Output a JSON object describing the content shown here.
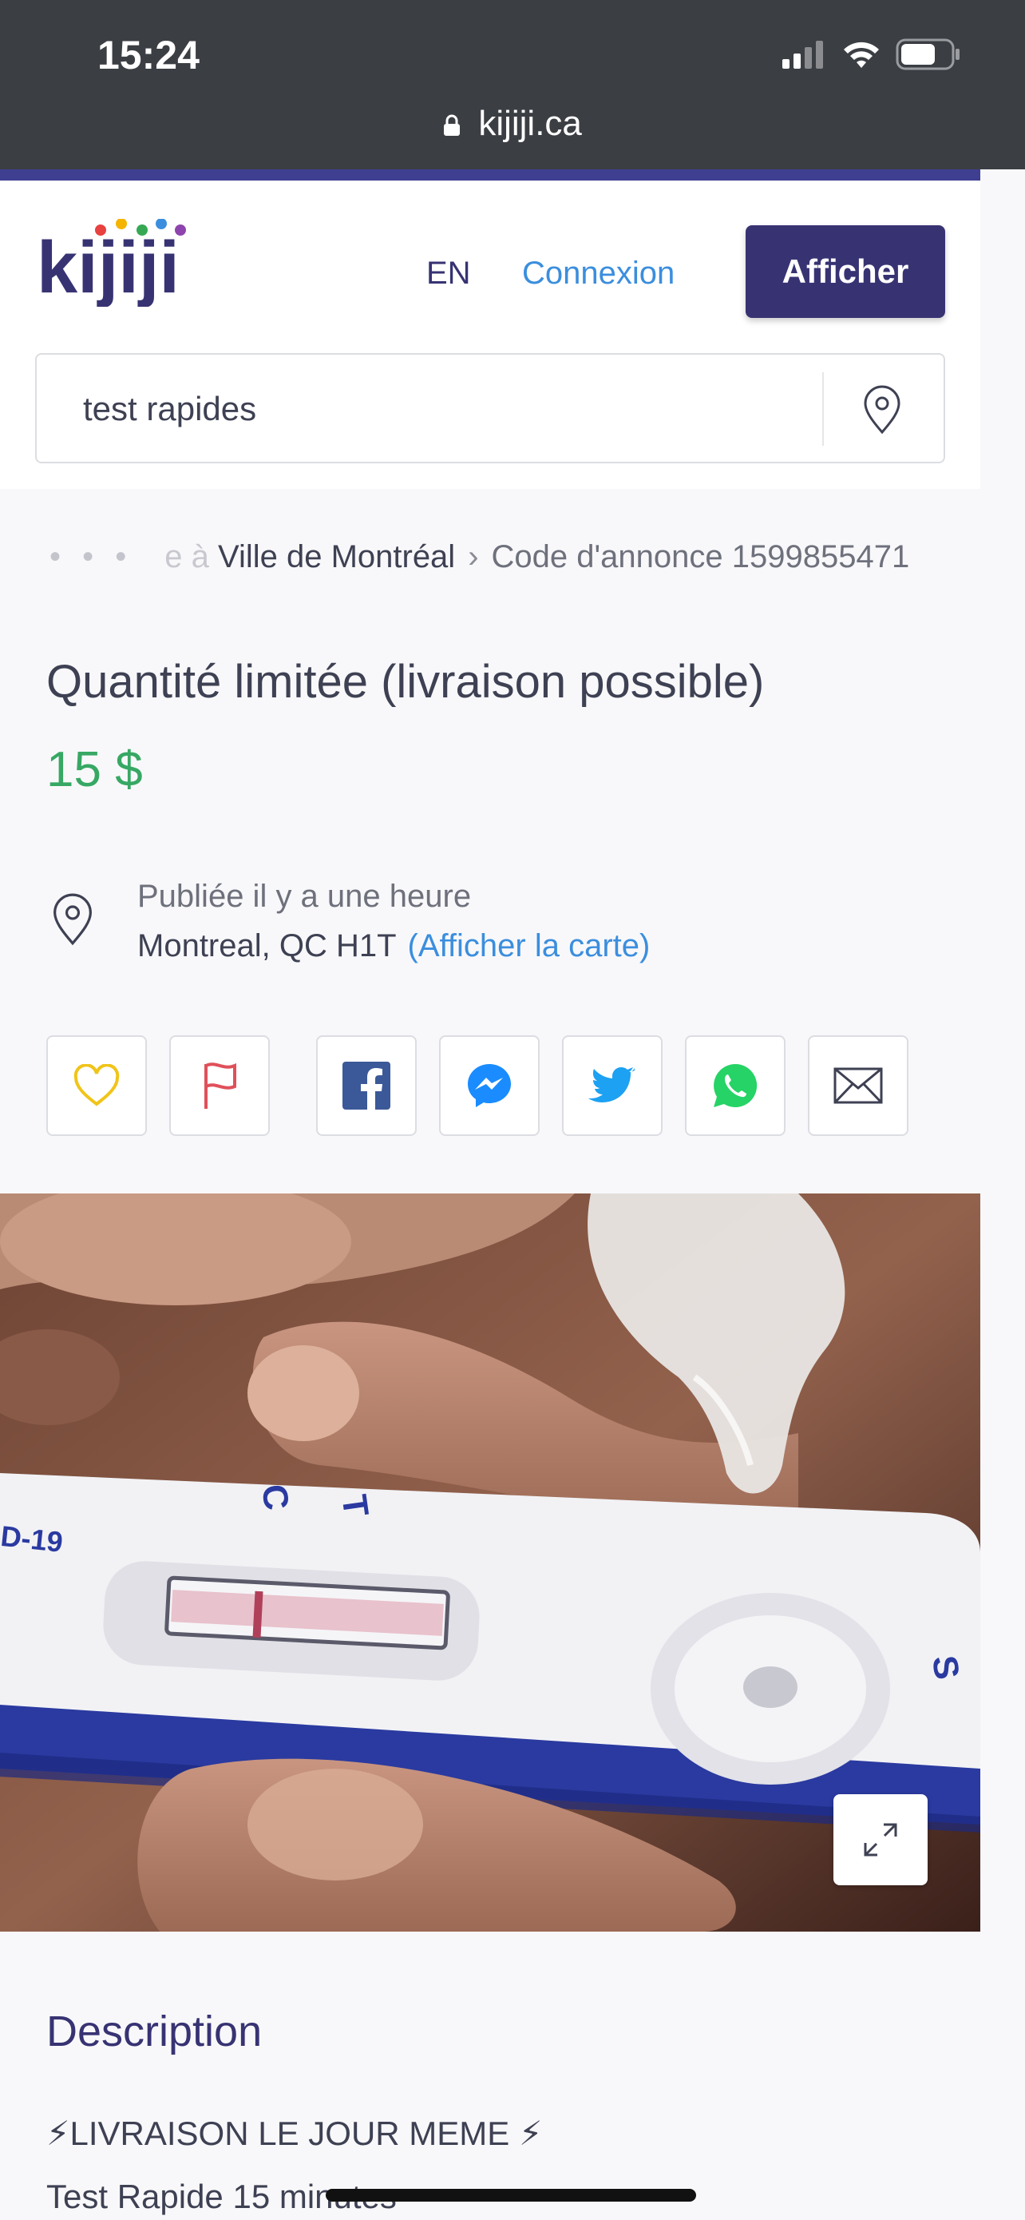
{
  "status_bar": {
    "time": "15:24",
    "url": "kijiji.ca"
  },
  "header": {
    "logo_text": "kijiji",
    "lang": "EN",
    "login": "Connexion",
    "post_button": "Afficher",
    "search_value": "test rapides"
  },
  "breadcrumb": {
    "ellipsis": "• • •",
    "faded": "e à",
    "city": "Ville de Montréal",
    "separator": "›",
    "ad_code": "Code d'annonce 1599855471"
  },
  "listing": {
    "title": "Quantité limitée (livraison possible)",
    "price": "15 $",
    "posted": "Publiée il y a une heure",
    "location": "Montreal, QC H1T",
    "map_link": "(Afficher la carte)"
  },
  "description": {
    "heading": "Description",
    "line1": "⚡LIVRAISON LE JOUR MEME ⚡",
    "line2": "Test Rapide 15 minutes"
  },
  "photo": {
    "test_labels": [
      "C",
      "T",
      "S",
      "D-19"
    ]
  },
  "colors": {
    "brand": "#373373",
    "price": "#37a864",
    "link": "#3b8ede",
    "facebook": "#3b5998",
    "messenger": "#1a8cff",
    "twitter": "#1da1f2",
    "whatsapp": "#25d366",
    "favorite": "#f0c419",
    "report": "#e0505a"
  }
}
